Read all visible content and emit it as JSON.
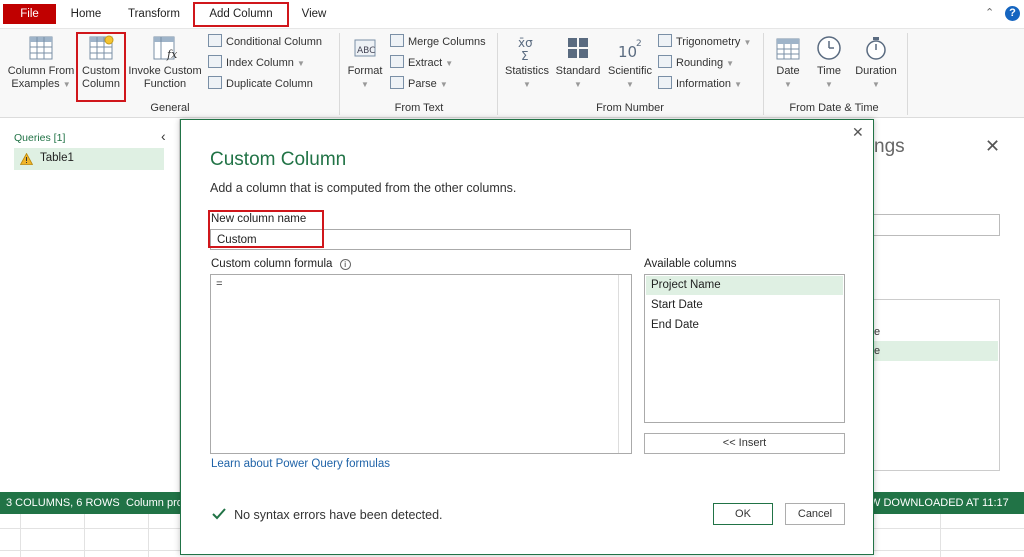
{
  "menu": {
    "file": "File",
    "home": "Home",
    "transform": "Transform",
    "add_column": "Add Column",
    "view": "View"
  },
  "ribbon": {
    "general": {
      "column_from_examples_line1": "Column From",
      "column_from_examples_line2": "Examples",
      "custom_column_line1": "Custom",
      "custom_column_line2": "Column",
      "invoke_custom_function_line1": "Invoke Custom",
      "invoke_custom_function_line2": "Function",
      "conditional_column": "Conditional Column",
      "index_column": "Index Column",
      "duplicate_column": "Duplicate Column",
      "label": "General"
    },
    "from_text": {
      "format": "Format",
      "merge_columns": "Merge Columns",
      "extract": "Extract",
      "parse": "Parse",
      "label": "From Text"
    },
    "from_number": {
      "statistics": "Statistics",
      "standard": "Standard",
      "scientific": "Scientific",
      "trigonometry": "Trigonometry",
      "rounding": "Rounding",
      "information": "Information",
      "label": "From Number"
    },
    "from_date_time": {
      "date": "Date",
      "time": "Time",
      "duration": "Duration",
      "label": "From Date & Time"
    }
  },
  "queries": {
    "header": "Queries [1]",
    "items": [
      "Table1"
    ]
  },
  "dialog": {
    "title": "Custom Column",
    "subtitle": "Add a column that is computed from the other columns.",
    "new_column_name_label": "New column name",
    "new_column_name_value": "Custom",
    "formula_label": "Custom column formula",
    "formula_value": "=",
    "available_columns_label": "Available columns",
    "available_columns": [
      "Project Name",
      "Start Date",
      "End Date"
    ],
    "insert_button": "<< Insert",
    "learn_link": "Learn about Power Query formulas",
    "status": "No syntax errors have been detected.",
    "ok": "OK",
    "cancel": "Cancel"
  },
  "right_pane": {
    "title_fragment": "ngs",
    "item_fragment_1": "e",
    "item_fragment_2": "e"
  },
  "statusbar": {
    "left": "3 COLUMNS, 6 ROWS",
    "left2": "Column pro",
    "right": "W DOWNLOADED AT 11:17 PM"
  },
  "colors": {
    "accent_green": "#217346",
    "file_red": "#c00000",
    "highlight_box": "#d0161b",
    "selected_row": "#dff0e3",
    "help_blue": "#1565c0"
  }
}
